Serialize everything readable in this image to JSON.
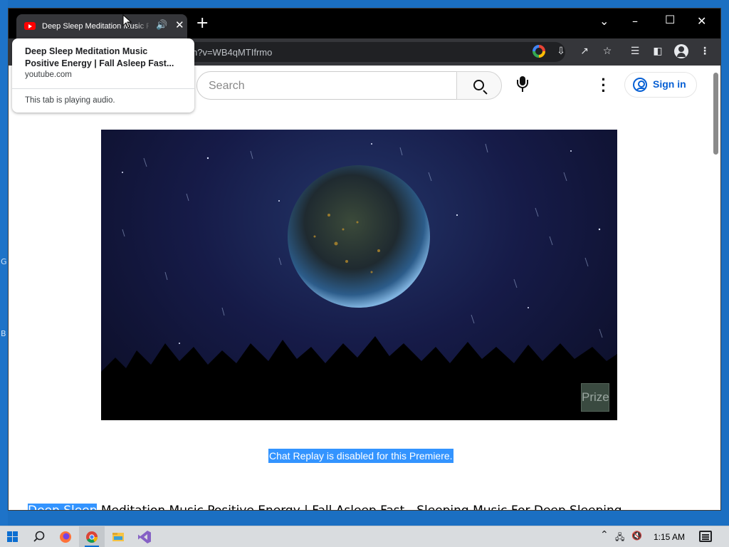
{
  "browser": {
    "tab_title": "Deep Sleep Meditation Music Positive Energy | Fall Asleep Fast - Sleeping Music For Deep Sleeping",
    "address_url": "h?v=WB4qMTIfrmo"
  },
  "tooltip": {
    "title_line1": "Deep Sleep Meditation Music",
    "title_line2": "Positive Energy | Fall Asleep Fast...",
    "domain": "youtube.com",
    "audio_status": "This tab is playing audio."
  },
  "youtube": {
    "search_placeholder": "Search",
    "sign_in_label": "Sign in",
    "video_overlay_label": "Prize",
    "chat_replay_notice": "Chat Replay is disabled for this Premiere.",
    "title_highlight": "Deep Sleep",
    "title_rest": " Meditation Music Positive Energy | Fall Asleep Fast - Sleeping Music For Deep Sleeping"
  },
  "desktop": {
    "edge_letters": [
      "G",
      "B"
    ]
  },
  "taskbar": {
    "clock": "1:15 AM",
    "apps": [
      "start-icon",
      "search-icon",
      "firefox-icon",
      "chrome-icon",
      "file-explorer-icon",
      "visual-studio-icon"
    ]
  },
  "colors": {
    "selection": "#3394ff",
    "youtube_red": "#ff0000",
    "youtube_link_blue": "#065fd4",
    "chrome_dark": "#35363a"
  }
}
